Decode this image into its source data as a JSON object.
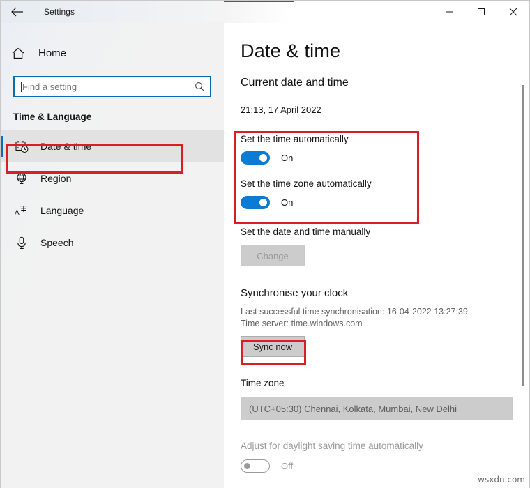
{
  "window": {
    "title": "Settings",
    "back_icon": "arrow-left-icon",
    "minimize_label": "Minimise",
    "maximize_label": "Maximise",
    "close_label": "Close",
    "accent_color": "#0d6cb5"
  },
  "sidebar": {
    "home_label": "Home",
    "home_icon": "home-icon",
    "search": {
      "placeholder": "Find a setting",
      "value": "",
      "icon": "search-icon"
    },
    "category_title": "Time & Language",
    "items": [
      {
        "label": "Date & time",
        "icon": "calendar-clock-icon",
        "selected": true
      },
      {
        "label": "Region",
        "icon": "globe-icon",
        "selected": false
      },
      {
        "label": "Language",
        "icon": "language-icon",
        "selected": false
      },
      {
        "label": "Speech",
        "icon": "microphone-icon",
        "selected": false
      }
    ]
  },
  "main": {
    "page_title": "Date & time",
    "current_section_heading": "Current date and time",
    "current_datetime": "21:13, 17 April 2022",
    "set_time_auto": {
      "label": "Set the time automatically",
      "state_text": "On",
      "on": true
    },
    "set_timezone_auto": {
      "label": "Set the time zone automatically",
      "state_text": "On",
      "on": true
    },
    "manual": {
      "label": "Set the date and time manually",
      "button_label": "Change",
      "button_disabled": true
    },
    "sync": {
      "heading": "Synchronise your clock",
      "last_sync_line": "Last successful time synchronisation: 16-04-2022 13:27:39",
      "time_server_line": "Time server: time.windows.com",
      "button_label": "Sync now"
    },
    "timezone": {
      "heading": "Time zone",
      "selected": "(UTC+05:30) Chennai, Kolkata, Mumbai, New Delhi"
    },
    "dst": {
      "label": "Adjust for daylight saving time automatically",
      "state_text": "Off",
      "on": false
    }
  },
  "annotations": {
    "color": "#d81f26",
    "boxes": [
      "date-time-nav-item",
      "automatic-time-toggles",
      "sync-now-button"
    ]
  },
  "watermark": "wsxdn.com"
}
